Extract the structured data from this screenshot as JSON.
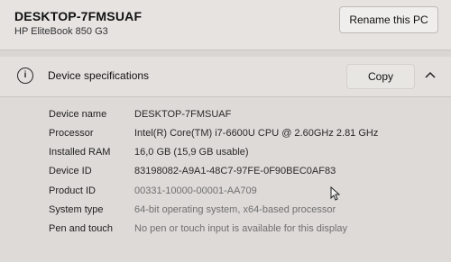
{
  "device": {
    "name": "DESKTOP-7FMSUAF",
    "model": "HP EliteBook 850 G3",
    "rename_label": "Rename this PC"
  },
  "specs": {
    "title": "Device specifications",
    "copy_label": "Copy",
    "rows": [
      {
        "label": "Device name",
        "value": "DESKTOP-7FMSUAF"
      },
      {
        "label": "Processor",
        "value": "Intel(R) Core(TM) i7-6600U CPU @ 2.60GHz   2.81 GHz"
      },
      {
        "label": "Installed RAM",
        "value": "16,0 GB (15,9 GB usable)"
      },
      {
        "label": "Device ID",
        "value": "83198082-A9A1-48C7-97FE-0F90BEC0AF83"
      },
      {
        "label": "Product ID",
        "value": "00331-10000-00001-AA709"
      },
      {
        "label": "System type",
        "value": "64-bit operating system, x64-based processor"
      },
      {
        "label": "Pen and touch",
        "value": "No pen or touch input is available for this display"
      }
    ]
  },
  "icons": {
    "info": "info-icon",
    "chevron": "chevron-up-icon",
    "cursor": "mouse-cursor-icon"
  }
}
